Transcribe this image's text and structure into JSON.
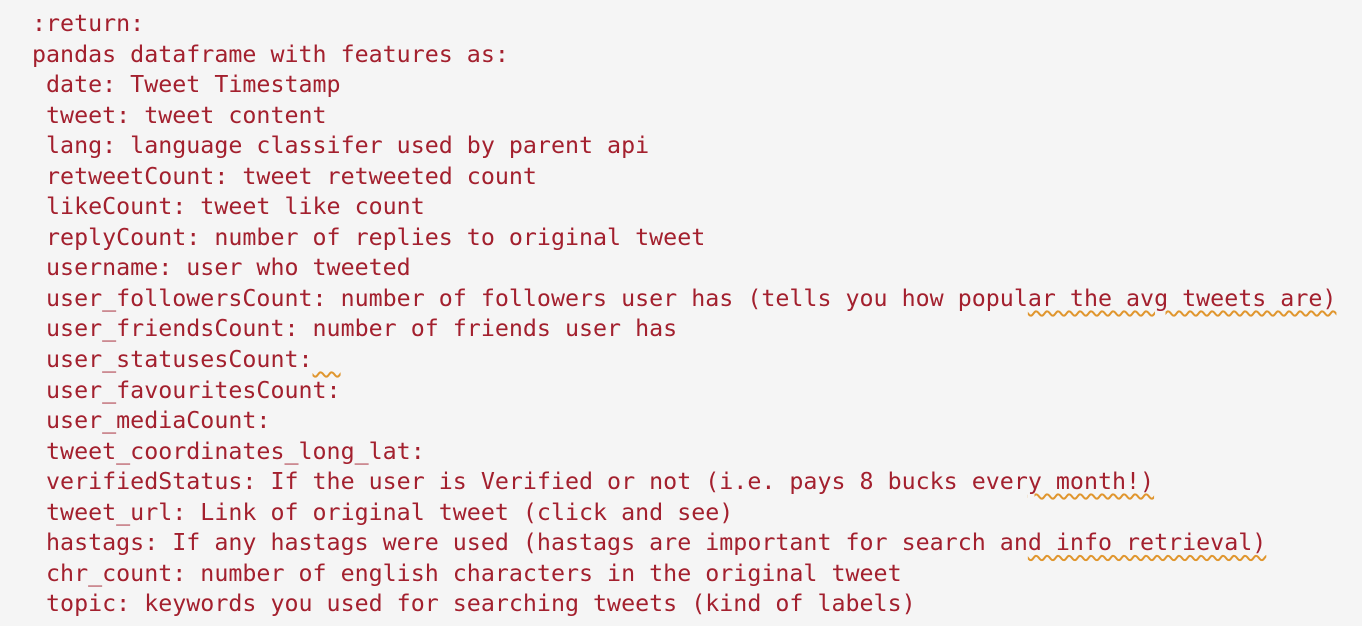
{
  "editor": {
    "text_color": "#a3202e",
    "background": "#f5f5f5",
    "warning_underline_color": "#e0962e",
    "lines": [
      {
        "pre": ":return:",
        "warn": "",
        "post": ""
      },
      {
        "pre": "pandas dataframe with features as:",
        "warn": "",
        "post": ""
      },
      {
        "pre": " date: Tweet Timestamp",
        "warn": "",
        "post": ""
      },
      {
        "pre": " tweet: tweet content",
        "warn": "",
        "post": ""
      },
      {
        "pre": " lang: language classifer used by parent api",
        "warn": "",
        "post": ""
      },
      {
        "pre": " retweetCount: tweet retweeted count",
        "warn": "",
        "post": ""
      },
      {
        "pre": " likeCount: tweet like count",
        "warn": "",
        "post": ""
      },
      {
        "pre": " replyCount: number of replies to original tweet",
        "warn": "",
        "post": ""
      },
      {
        "pre": " username: user who tweeted",
        "warn": "",
        "post": ""
      },
      {
        "pre": " user_followersCount: number of followers user has (tells you how popul",
        "warn": "ar the avg tweets are)",
        "post": ""
      },
      {
        "pre": " user_friendsCount: number of friends user has",
        "warn": "",
        "post": ""
      },
      {
        "pre": " user_statusesCount:",
        "warn": "  ",
        "post": ""
      },
      {
        "pre": " user_favouritesCount:",
        "warn": "",
        "post": ""
      },
      {
        "pre": " user_mediaCount:",
        "warn": "",
        "post": ""
      },
      {
        "pre": " tweet_coordinates_long_lat:",
        "warn": "",
        "post": ""
      },
      {
        "pre": " verifiedStatus: If the user is Verified or not (i.e. pays 8 bucks ever",
        "warn": "y month!)",
        "post": ""
      },
      {
        "pre": " tweet_url: Link of original tweet (click and see)",
        "warn": "",
        "post": ""
      },
      {
        "pre": " hastags: If any hastags were used (hastags are important for search an",
        "warn": "d info retrieval)",
        "post": ""
      },
      {
        "pre": " chr_count: number of english characters in the original tweet",
        "warn": "",
        "post": ""
      },
      {
        "pre": " topic: keywords you used for searching tweets (kind of labels)",
        "warn": "",
        "post": ""
      }
    ]
  }
}
